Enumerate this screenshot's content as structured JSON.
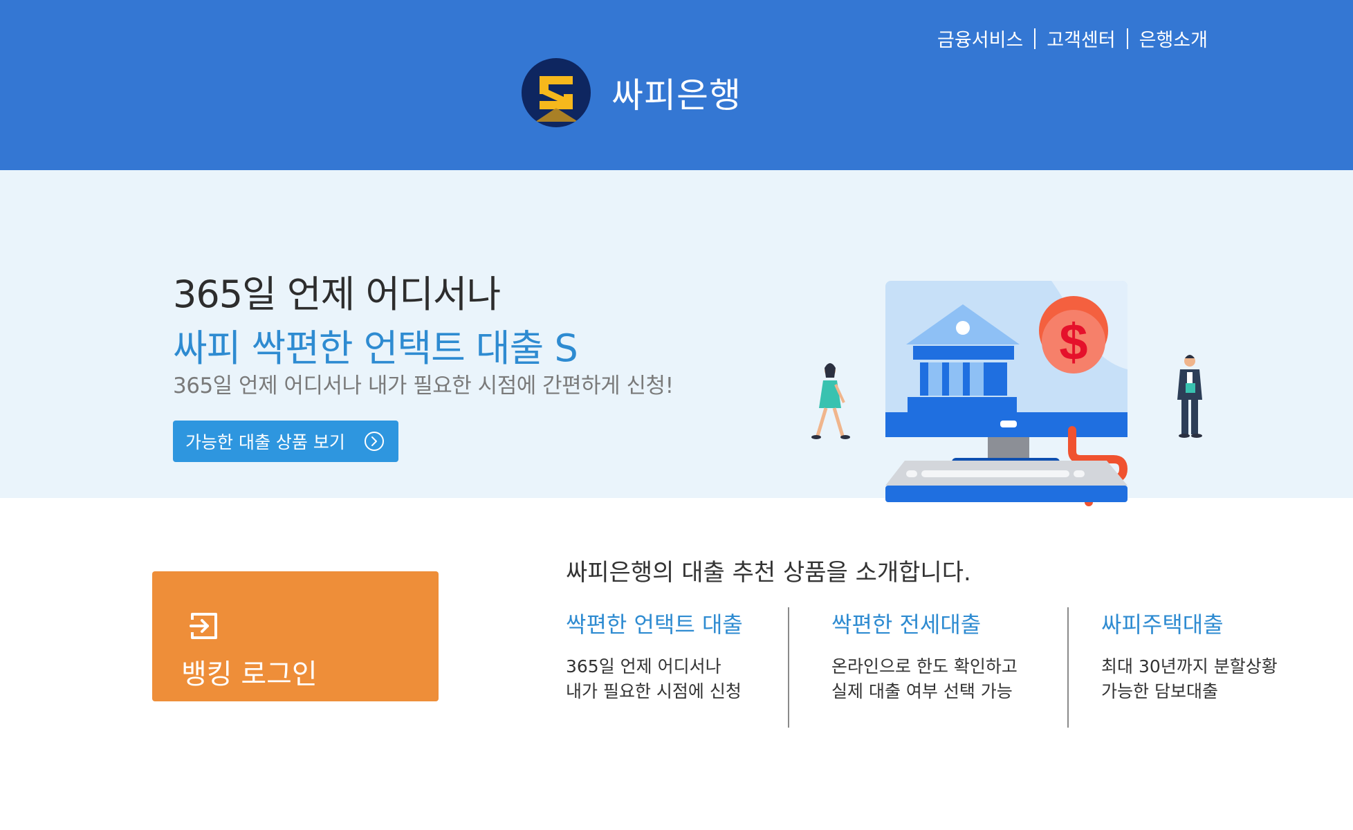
{
  "top_nav": {
    "items": [
      "금융서비스",
      "고객센터",
      "은행소개"
    ]
  },
  "brand": {
    "name": "싸피은행"
  },
  "hero": {
    "title": "365일 언제 어디서나",
    "subtitle": "싸피 싹편한 언택트 대출 S",
    "description": "365일 언제 어디서나 내가 필요한 시점에 간편하게 신청!",
    "button_label": "가능한 대출 상품 보기"
  },
  "login": {
    "label": "뱅킹 로그인"
  },
  "recommend": {
    "title": "싸피은행의 대출 추천 상품을 소개합니다.",
    "products": [
      {
        "name": "싹편한 언택트 대출",
        "lines": [
          "365일 언제 어디서나",
          "내가 필요한 시점에 신청"
        ]
      },
      {
        "name": "싹편한 전세대출",
        "lines": [
          "온라인으로 한도 확인하고",
          "실제 대출 여부 선택 가능"
        ]
      },
      {
        "name": "싸피주택대출",
        "lines": [
          "최대 30년까지 분할상황",
          "가능한 담보대출"
        ]
      }
    ]
  },
  "colors": {
    "header_blue": "#3477d3",
    "hero_bg": "#eaf4fb",
    "accent_blue": "#2e8bd1",
    "login_orange": "#ee8e39"
  },
  "icons": {
    "logo": "bank-s-logo-icon",
    "hero_button": "chevron-right-circle-icon",
    "login": "sign-in-icon"
  }
}
